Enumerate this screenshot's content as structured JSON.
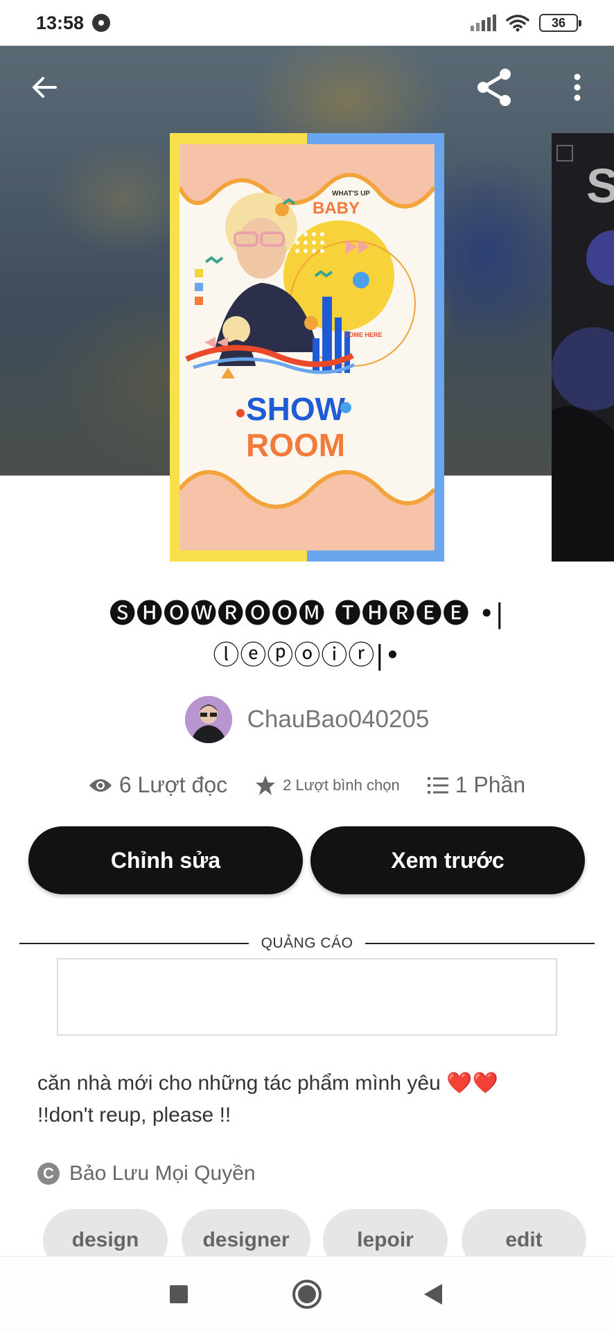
{
  "status_bar": {
    "time": "13:58",
    "battery": "36",
    "icons": [
      "notification-icon",
      "signal-icon",
      "wifi-icon",
      "battery-icon"
    ]
  },
  "header": {
    "icons": [
      "back-arrow-icon",
      "share-icon",
      "more-vertical-icon"
    ]
  },
  "cover": {
    "text_top": "WHAT'S UP",
    "text_baby": "BABY",
    "text_show": "SHOW",
    "text_room": "ROOM",
    "text_come": "COME HERE",
    "side_letter": "S"
  },
  "story": {
    "title_line1": "🅢🅗🅞🅦🅡🅞🅞🅜 🅣🅗🅡🅔🅔 •|",
    "title_line2": "ⓛⓔⓟⓞⓘⓡ|•",
    "author": "ChauBao040205",
    "reads": "6 Lượt đọc",
    "votes": "2 Lượt bình chọn",
    "parts": "1 Phần",
    "description_line1": "căn nhà mới cho những tác phẩm mình yêu",
    "hearts": "❤️❤️",
    "description_line2": "!!don't reup, please !!",
    "copyright": "Bảo Lưu Mọi Quyền"
  },
  "actions": {
    "edit": "Chỉnh sửa",
    "preview": "Xem trước"
  },
  "ad": {
    "label": "QUẢNG CÁO"
  },
  "tags": [
    "design",
    "designer",
    "lepoir",
    "edit"
  ],
  "colors": {
    "button_bg": "#121212",
    "cover_left": "#f8e04a",
    "cover_right": "#6aa6ee",
    "tag_bg": "#e6e6e6",
    "heart": "#d8141c"
  }
}
